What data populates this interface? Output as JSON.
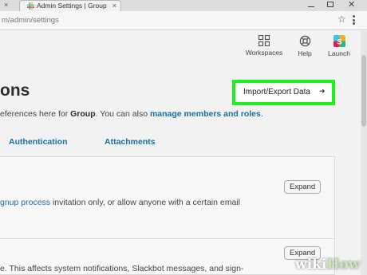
{
  "browser": {
    "tab_title": "Admin Settings | Group",
    "tab_close": "×",
    "url": "m/admin/settings",
    "close_glyph": "✕"
  },
  "topnav": {
    "workspaces": "Workspaces",
    "help": "Help",
    "launch": "Launch",
    "launch_color": "#ecb22e"
  },
  "page": {
    "title": "ons",
    "import_export_label": "Import/Export Data",
    "import_arrow": "➜",
    "desc_prefix": "eferences here for ",
    "desc_workspace": "Group",
    "desc_mid": ". You can also ",
    "desc_link": "manage members and roles",
    "desc_suffix": ".",
    "highlight_color": "#1df11d"
  },
  "tabs": {
    "authentication": "Authentication",
    "attachments": "Attachments"
  },
  "settings": {
    "expand_label": "Expand",
    "row1_link": "gnup process",
    "row1_text": " invitation only, or allow anyone with a certain email",
    "row2_text": "e. This affects system notifications, Slackbot messages, and sign-"
  },
  "watermark": {
    "wiki": "wiki",
    "how": "How"
  }
}
